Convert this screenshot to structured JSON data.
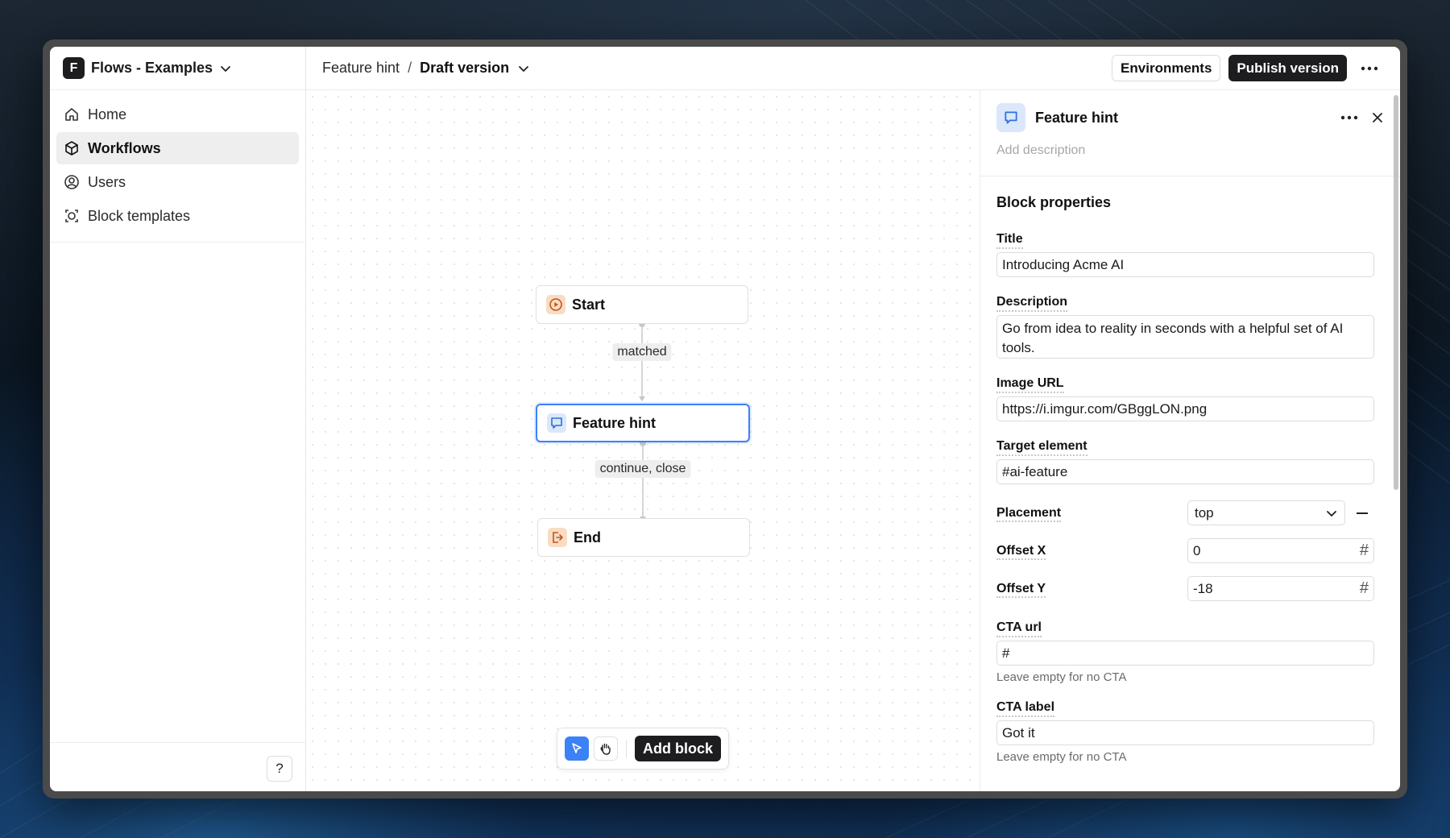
{
  "workspace": {
    "logo_letter": "F",
    "name": "Flows - Examples"
  },
  "sidebar": {
    "items": [
      {
        "label": "Home",
        "icon": "home-icon",
        "active": false
      },
      {
        "label": "Workflows",
        "icon": "workflow-icon",
        "active": true
      },
      {
        "label": "Users",
        "icon": "user-icon",
        "active": false
      },
      {
        "label": "Block templates",
        "icon": "block-template-icon",
        "active": false
      }
    ],
    "help_label": "?"
  },
  "header": {
    "breadcrumb_parent": "Feature hint",
    "breadcrumb_sep": "/",
    "breadcrumb_current": "Draft version",
    "environments_label": "Environments",
    "publish_label": "Publish version"
  },
  "canvas": {
    "nodes": [
      {
        "label": "Start",
        "icon": "play-icon"
      },
      {
        "label": "Feature hint",
        "icon": "message-icon",
        "selected": true
      },
      {
        "label": "End",
        "icon": "exit-icon"
      }
    ],
    "edges": [
      {
        "label": "matched"
      },
      {
        "label": "continue, close"
      }
    ],
    "toolbar": {
      "add_block_label": "Add block"
    }
  },
  "panel": {
    "title": "Feature hint",
    "description_placeholder": "Add description",
    "section_title": "Block properties",
    "title_field": {
      "label": "Title",
      "value": "Introducing Acme AI"
    },
    "description_field": {
      "label": "Description",
      "value": "Go from idea to reality in seconds with a helpful set of AI tools."
    },
    "image_field": {
      "label": "Image URL",
      "value": "https://i.imgur.com/GBggLON.png"
    },
    "target_field": {
      "label": "Target element",
      "value": "#ai-feature"
    },
    "placement_field": {
      "label": "Placement",
      "value": "top"
    },
    "offset_x_field": {
      "label": "Offset X",
      "value": "0",
      "suffix": "#"
    },
    "offset_y_field": {
      "label": "Offset Y",
      "value": "-18",
      "suffix": "#"
    },
    "cta_url_field": {
      "label": "CTA url",
      "value": "#",
      "hint": "Leave empty for no CTA"
    },
    "cta_label_field": {
      "label": "CTA label",
      "value": "Got it",
      "hint": "Leave empty for no CTA"
    }
  },
  "colors": {
    "accent": "#3b82f6",
    "dark": "#1d1d1f",
    "node_orange": "#f9dcc4",
    "node_blue": "#dbe7fb"
  }
}
